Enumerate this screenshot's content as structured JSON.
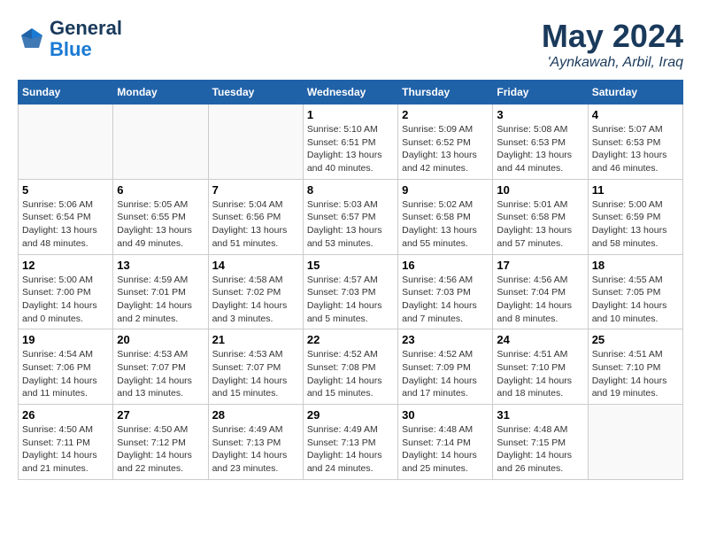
{
  "header": {
    "logo_line1": "General",
    "logo_line2": "Blue",
    "month": "May 2024",
    "location": "'Aynkawah, Arbil, Iraq"
  },
  "weekdays": [
    "Sunday",
    "Monday",
    "Tuesday",
    "Wednesday",
    "Thursday",
    "Friday",
    "Saturday"
  ],
  "weeks": [
    [
      {
        "day": "",
        "info": ""
      },
      {
        "day": "",
        "info": ""
      },
      {
        "day": "",
        "info": ""
      },
      {
        "day": "1",
        "info": "Sunrise: 5:10 AM\nSunset: 6:51 PM\nDaylight: 13 hours\nand 40 minutes."
      },
      {
        "day": "2",
        "info": "Sunrise: 5:09 AM\nSunset: 6:52 PM\nDaylight: 13 hours\nand 42 minutes."
      },
      {
        "day": "3",
        "info": "Sunrise: 5:08 AM\nSunset: 6:53 PM\nDaylight: 13 hours\nand 44 minutes."
      },
      {
        "day": "4",
        "info": "Sunrise: 5:07 AM\nSunset: 6:53 PM\nDaylight: 13 hours\nand 46 minutes."
      }
    ],
    [
      {
        "day": "5",
        "info": "Sunrise: 5:06 AM\nSunset: 6:54 PM\nDaylight: 13 hours\nand 48 minutes."
      },
      {
        "day": "6",
        "info": "Sunrise: 5:05 AM\nSunset: 6:55 PM\nDaylight: 13 hours\nand 49 minutes."
      },
      {
        "day": "7",
        "info": "Sunrise: 5:04 AM\nSunset: 6:56 PM\nDaylight: 13 hours\nand 51 minutes."
      },
      {
        "day": "8",
        "info": "Sunrise: 5:03 AM\nSunset: 6:57 PM\nDaylight: 13 hours\nand 53 minutes."
      },
      {
        "day": "9",
        "info": "Sunrise: 5:02 AM\nSunset: 6:58 PM\nDaylight: 13 hours\nand 55 minutes."
      },
      {
        "day": "10",
        "info": "Sunrise: 5:01 AM\nSunset: 6:58 PM\nDaylight: 13 hours\nand 57 minutes."
      },
      {
        "day": "11",
        "info": "Sunrise: 5:00 AM\nSunset: 6:59 PM\nDaylight: 13 hours\nand 58 minutes."
      }
    ],
    [
      {
        "day": "12",
        "info": "Sunrise: 5:00 AM\nSunset: 7:00 PM\nDaylight: 14 hours\nand 0 minutes."
      },
      {
        "day": "13",
        "info": "Sunrise: 4:59 AM\nSunset: 7:01 PM\nDaylight: 14 hours\nand 2 minutes."
      },
      {
        "day": "14",
        "info": "Sunrise: 4:58 AM\nSunset: 7:02 PM\nDaylight: 14 hours\nand 3 minutes."
      },
      {
        "day": "15",
        "info": "Sunrise: 4:57 AM\nSunset: 7:03 PM\nDaylight: 14 hours\nand 5 minutes."
      },
      {
        "day": "16",
        "info": "Sunrise: 4:56 AM\nSunset: 7:03 PM\nDaylight: 14 hours\nand 7 minutes."
      },
      {
        "day": "17",
        "info": "Sunrise: 4:56 AM\nSunset: 7:04 PM\nDaylight: 14 hours\nand 8 minutes."
      },
      {
        "day": "18",
        "info": "Sunrise: 4:55 AM\nSunset: 7:05 PM\nDaylight: 14 hours\nand 10 minutes."
      }
    ],
    [
      {
        "day": "19",
        "info": "Sunrise: 4:54 AM\nSunset: 7:06 PM\nDaylight: 14 hours\nand 11 minutes."
      },
      {
        "day": "20",
        "info": "Sunrise: 4:53 AM\nSunset: 7:07 PM\nDaylight: 14 hours\nand 13 minutes."
      },
      {
        "day": "21",
        "info": "Sunrise: 4:53 AM\nSunset: 7:07 PM\nDaylight: 14 hours\nand 15 minutes."
      },
      {
        "day": "22",
        "info": "Sunrise: 4:52 AM\nSunset: 7:08 PM\nDaylight: 14 hours\nand 15 minutes."
      },
      {
        "day": "23",
        "info": "Sunrise: 4:52 AM\nSunset: 7:09 PM\nDaylight: 14 hours\nand 17 minutes."
      },
      {
        "day": "24",
        "info": "Sunrise: 4:51 AM\nSunset: 7:10 PM\nDaylight: 14 hours\nand 18 minutes."
      },
      {
        "day": "25",
        "info": "Sunrise: 4:51 AM\nSunset: 7:10 PM\nDaylight: 14 hours\nand 19 minutes."
      }
    ],
    [
      {
        "day": "26",
        "info": "Sunrise: 4:50 AM\nSunset: 7:11 PM\nDaylight: 14 hours\nand 21 minutes."
      },
      {
        "day": "27",
        "info": "Sunrise: 4:50 AM\nSunset: 7:12 PM\nDaylight: 14 hours\nand 22 minutes."
      },
      {
        "day": "28",
        "info": "Sunrise: 4:49 AM\nSunset: 7:13 PM\nDaylight: 14 hours\nand 23 minutes."
      },
      {
        "day": "29",
        "info": "Sunrise: 4:49 AM\nSunset: 7:13 PM\nDaylight: 14 hours\nand 24 minutes."
      },
      {
        "day": "30",
        "info": "Sunrise: 4:48 AM\nSunset: 7:14 PM\nDaylight: 14 hours\nand 25 minutes."
      },
      {
        "day": "31",
        "info": "Sunrise: 4:48 AM\nSunset: 7:15 PM\nDaylight: 14 hours\nand 26 minutes."
      },
      {
        "day": "",
        "info": ""
      }
    ]
  ]
}
